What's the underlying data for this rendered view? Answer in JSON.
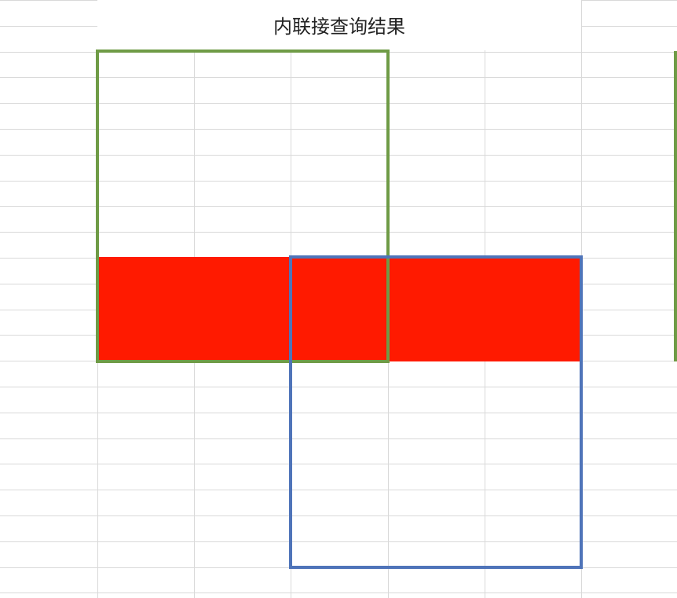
{
  "title": "内联接查询结果",
  "colors": {
    "grid": "#d9d9d9",
    "left_table_border": "#6f9b46",
    "right_table_border": "#4f74b9",
    "intersection_fill": "#ff1a00",
    "background": "#ffffff"
  }
}
